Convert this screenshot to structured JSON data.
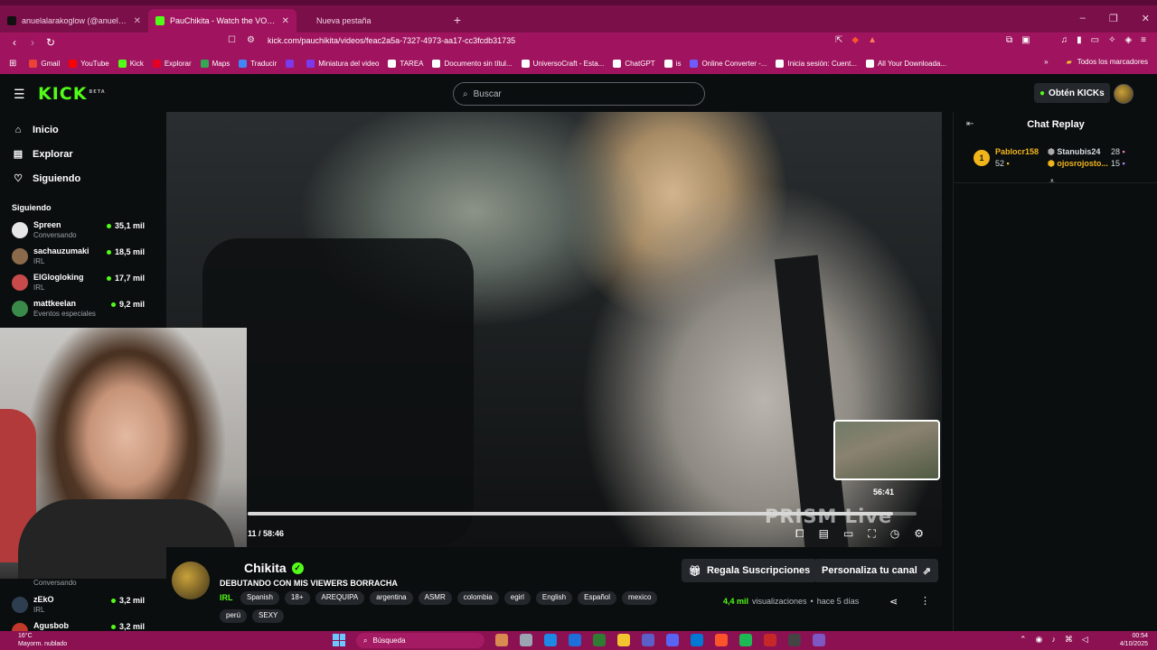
{
  "browser": {
    "tabs": [
      {
        "label": "anuelalarakoglow (@anuelalarakoglow",
        "color": "#111111"
      },
      {
        "label": "PauChikita - Watch the VOD on Kick",
        "color": "#53fc18"
      },
      {
        "label": "Nueva pestaña",
        "color": "#a0135f"
      }
    ],
    "new_tab": "+",
    "url": "kick.com/pauchikita/videos/feac2a5a-7327-4973-aa17-cc3fcdb31735",
    "bookmarks": [
      {
        "label": "Gmail",
        "color": "#ea4335"
      },
      {
        "label": "YouTube",
        "color": "#ff0000"
      },
      {
        "label": "Kick",
        "color": "#53fc18"
      },
      {
        "label": "Explorar",
        "color": "#e60023"
      },
      {
        "label": "Maps",
        "color": "#34a853"
      },
      {
        "label": "Traducir",
        "color": "#4285f4"
      },
      {
        "label": "",
        "color": "#7c3aed"
      },
      {
        "label": "Miniatura del video",
        "color": "#7c3aed"
      },
      {
        "label": "TAREA",
        "color": "#ffffff"
      },
      {
        "label": "Documento sin títul...",
        "color": "#ffffff"
      },
      {
        "label": "UniversoCraft - Esta...",
        "color": "#ffffff"
      },
      {
        "label": "ChatGPT",
        "color": "#ffffff"
      },
      {
        "label": "is",
        "color": "#ffffff"
      },
      {
        "label": "Online Converter -...",
        "color": "#6d5dfc"
      },
      {
        "label": "Inicia sesión: Cuent...",
        "color": "#ffffff"
      },
      {
        "label": "All Your Downloada...",
        "color": "#ffffff"
      }
    ],
    "bookmarks_more": "»",
    "all_bookmarks": "Todos los marcadores"
  },
  "kick": {
    "logo": "KICK",
    "logo_badge": "BETA",
    "search_placeholder": "Buscar",
    "kicks_button": "Obtén KICKs"
  },
  "sidebar": {
    "nav": [
      {
        "label": "Inicio",
        "icon": "home-icon",
        "glyph": "⌂"
      },
      {
        "label": "Explorar",
        "icon": "browse-icon",
        "glyph": "▤"
      },
      {
        "label": "Siguiendo",
        "icon": "heart-icon",
        "glyph": "♡"
      }
    ],
    "following_title": "Siguiendo",
    "following": [
      {
        "name": "Spreen",
        "category": "Conversando",
        "viewers": "35,1 mil",
        "color": "#e6e6e6"
      },
      {
        "name": "sachauzumaki",
        "category": "IRL",
        "viewers": "18,5 mil",
        "color": "#8a6a4a"
      },
      {
        "name": "ElGlogloking",
        "category": "IRL",
        "viewers": "17,7 mil",
        "color": "#c94a4a"
      },
      {
        "name": "mattkeelan",
        "category": "Eventos especiales",
        "viewers": "9,2 mil",
        "color": "#3a8a4a"
      }
    ],
    "lower": [
      {
        "name": "",
        "category": "Conversando",
        "viewers": "",
        "color": "#0b0e0f"
      },
      {
        "name": "zEkO",
        "category": "IRL",
        "viewers": "3,2 mil",
        "color": "#2c3e50"
      },
      {
        "name": "Agusbob",
        "category": "",
        "viewers": "3,2 mil",
        "color": "#c0392b"
      }
    ]
  },
  "player": {
    "timecode": "11 / 58:46",
    "preview_time": "56:41",
    "watermark": "PRISM Live",
    "progress": 0.965
  },
  "stream": {
    "channel": "Chikita",
    "title": "DEBUTANDO CON MIS VIEWERS BORRACHA",
    "category": "IRL",
    "tags": [
      "Spanish",
      "18+",
      "AREQUIPA",
      "argentina",
      "ASMR",
      "colombia",
      "egirl",
      "English",
      "Español",
      "mexico"
    ],
    "tags_row2": [
      "perú",
      "SEXY"
    ],
    "gift_button": "Regala Suscripciones",
    "customize_button": "Personaliza tu canal",
    "views_count": "4,4 mil",
    "views_label": "visualizaciones",
    "dot": "•",
    "ago": "hace 5 días"
  },
  "chat": {
    "title": "Chat Replay",
    "top_gifter_rank": "1",
    "gifters": [
      {
        "name": "Pablocr158",
        "count": "52"
      },
      {
        "name": "Stanubis24",
        "count": "28"
      },
      {
        "name": "ojosrojosto...",
        "count": "15"
      }
    ]
  },
  "taskbar": {
    "temp": "16°C",
    "weather": "Mayorm. nublado",
    "search": "Búsqueda",
    "time": "00:54",
    "date": "4/10/2025",
    "app_colors": [
      "#d98a50",
      "#9aa5b1",
      "#1e88e5",
      "#1e6fd9",
      "#2e7d32",
      "#f4c430",
      "#5b5fc7",
      "#5865f2",
      "#0078d4",
      "#fb542b",
      "#1db954",
      "#c62828",
      "#444444",
      "#7e57c2"
    ]
  }
}
